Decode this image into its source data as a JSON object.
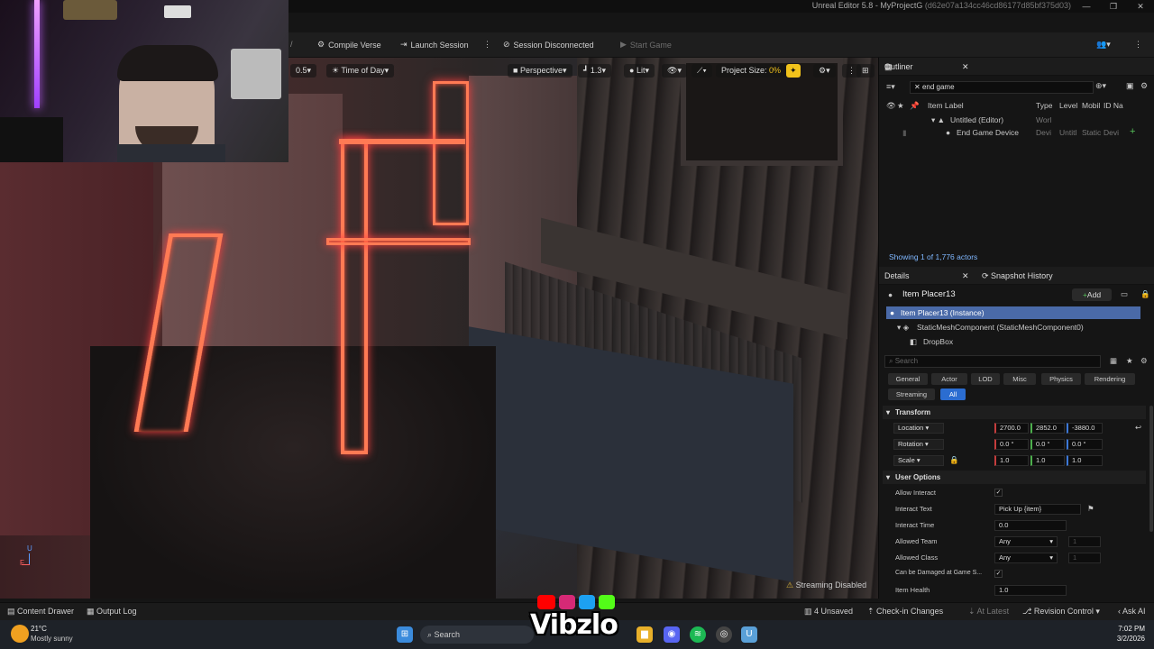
{
  "window": {
    "title": "Unreal Editor 5.8 - MyProjectG",
    "hash": "(d62e07a134cc46cd86177d85bf375d03)"
  },
  "toolbar": {
    "compile_label": "Compile Verse",
    "launch_label": "Launch Session",
    "session_label": "Session Disconnected",
    "start_label": "Start Game"
  },
  "viewport": {
    "speed": "0.5",
    "time_of_day": "Time of Day",
    "perspective": "Perspective",
    "scale": "1.3",
    "lit": "Lit",
    "project_size_label": "Project Size:",
    "project_size_value": "0%",
    "streaming": "Streaming Disabled",
    "axis_z": "U",
    "axis_x": "F"
  },
  "outliner": {
    "tab": "Outliner",
    "search_value": "end game",
    "col_label": "Item Label",
    "col_type": "Type",
    "col_level": "Level",
    "col_mobil": "Mobil",
    "col_id": "ID Na",
    "rows": [
      {
        "label": "Untitled (Editor)",
        "type": "Worl",
        "level": "",
        "mobil": "",
        "id": ""
      },
      {
        "label": "End Game Device",
        "type": "Devi",
        "level": "Untitl",
        "mobil": "Static",
        "id": "Devi"
      }
    ],
    "count": "Showing 1 of 1,776 actors"
  },
  "details": {
    "tab": "Details",
    "tab2": "Snapshot History",
    "actor_name": "Item Placer13",
    "add_label": "Add",
    "instance": "Item Placer13 (Instance)",
    "component": "StaticMeshComponent (StaticMeshComponent0)",
    "subcomponent": "DropBox",
    "search_placeholder": "Search",
    "filters": [
      "General",
      "Actor",
      "LOD",
      "Misc",
      "Physics",
      "Rendering",
      "Streaming",
      "All"
    ],
    "transform_header": "Transform",
    "location_label": "Location",
    "location": [
      "2700.0",
      "2852.0",
      "-3880.0"
    ],
    "rotation_label": "Rotation",
    "rotation": [
      "0.0 °",
      "0.0 °",
      "0.0 °"
    ],
    "scale_label": "Scale",
    "scale": [
      "1.0",
      "1.0",
      "1.0"
    ],
    "user_options_header": "User Options",
    "allow_interact_label": "Allow Interact",
    "interact_text_label": "Interact Text",
    "interact_text_value": "Pick Up {item}",
    "interact_time_label": "Interact Time",
    "interact_time_value": "0.0",
    "allowed_team_label": "Allowed Team",
    "allowed_team_value": "Any",
    "allowed_team_num": "1",
    "allowed_class_label": "Allowed Class",
    "allowed_class_value": "Any",
    "allowed_class_num": "1",
    "damaged_label": "Can be Damaged at Game S...",
    "item_health_label": "Item Health",
    "item_health_value": "1.0"
  },
  "bottombar": {
    "content_drawer": "Content Drawer",
    "output_log": "Output Log",
    "unsaved": "4 Unsaved",
    "checkin": "Check-in Changes",
    "at_latest": "At Latest",
    "revision": "Revision Control",
    "ask_ai": "Ask AI"
  },
  "taskbar": {
    "weather_temp": "21°C",
    "weather_desc": "Mostly sunny",
    "search": "Search",
    "time": "7:02 PM",
    "date": "3/2/2026",
    "watermark": "Vibzlo"
  },
  "colors": {
    "accent_blue": "#2b6dd1",
    "glow": "#ff7a54",
    "yellow": "#f1c21b"
  }
}
